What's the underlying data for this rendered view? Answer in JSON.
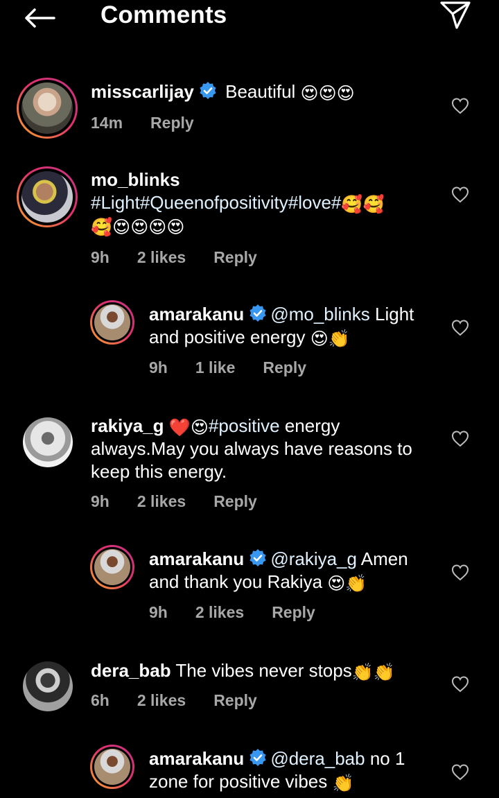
{
  "header": {
    "title": "Comments"
  },
  "comments": [
    {
      "username": "misscarlijay",
      "verified": true,
      "text": "Beautiful",
      "emojis": "😍😍😍",
      "time": "14m",
      "likes": "",
      "reply_label": "Reply"
    },
    {
      "username": "mo_blinks",
      "verified": false,
      "text": "#Light#Queenofpositivity#love#",
      "emojis_line1": "🥰🥰",
      "emojis_line2": "🥰😍😍😍😍",
      "time": "9h",
      "likes": "2 likes",
      "reply_label": "Reply"
    },
    {
      "username": "amarakanu",
      "verified": true,
      "mention": "@mo_blinks",
      "text_line1": "Light",
      "text_line2": "and positive energy",
      "emojis": "😍👏",
      "time": "9h",
      "likes": "1 like",
      "reply_label": "Reply"
    },
    {
      "username": "rakiya_g",
      "verified": false,
      "emojis_lead": "❤️😍",
      "hashtag": "#positive",
      "text_line1": "energy",
      "text_line2": "always.May you always have reasons to",
      "text_line3": "keep this energy.",
      "time": "9h",
      "likes": "2 likes",
      "reply_label": "Reply"
    },
    {
      "username": "amarakanu",
      "verified": true,
      "mention": "@rakiya_g",
      "text_line1": "Amen",
      "text_line2": "and thank you Rakiya",
      "emojis": "😍👏",
      "time": "9h",
      "likes": "2 likes",
      "reply_label": "Reply"
    },
    {
      "username": "dera_bab",
      "verified": false,
      "text": "The vibes never stops",
      "emojis": "👏👏",
      "time": "6h",
      "likes": "2 likes",
      "reply_label": "Reply"
    },
    {
      "username": "amarakanu",
      "verified": true,
      "mention": "@dera_bab",
      "text_line1": "no 1",
      "text_line2": "zone for positive vibes",
      "emojis": "👏"
    }
  ],
  "icons": {
    "back": "arrow-left-icon",
    "send": "paper-plane-icon",
    "verified": "verified-badge-icon",
    "like": "heart-outline-icon"
  },
  "colors": {
    "background": "#000000",
    "text": "#ffffff",
    "meta": "#a8a8a8",
    "verified": "#3897f0"
  }
}
